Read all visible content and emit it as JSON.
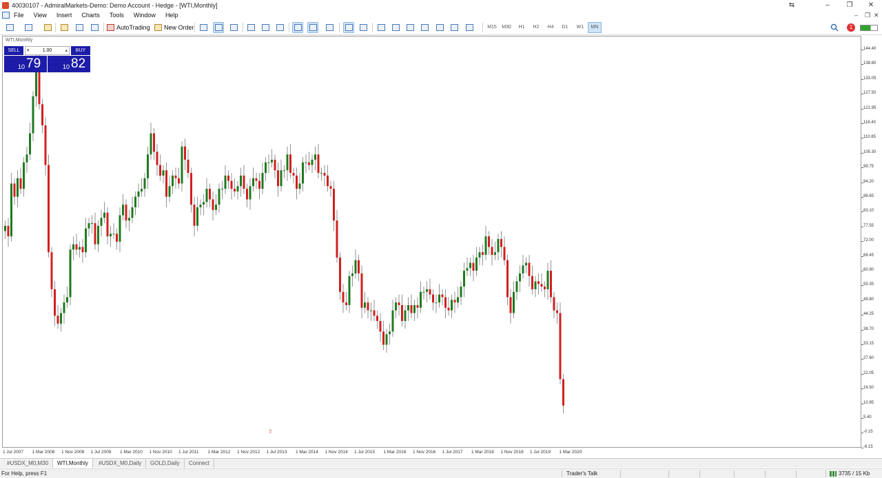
{
  "window": {
    "title": "40030107 - AdmiralMarkets-Demo: Demo Account - Hedge - [WTI,Monthly]",
    "controls": [
      "⇆",
      "–",
      "❐",
      "✕"
    ]
  },
  "menu": {
    "items": [
      "File",
      "View",
      "Insert",
      "Charts",
      "Tools",
      "Window",
      "Help"
    ],
    "mdi_controls": [
      "–",
      "❐",
      "✕"
    ]
  },
  "toolbar": {
    "autotrading_label": "AutoTrading",
    "new_order_label": "New Order",
    "timeframes": [
      "M15",
      "M30",
      "H1",
      "H2",
      "H4",
      "D1",
      "W1",
      "MN"
    ],
    "active_timeframe": "MN",
    "notification_count": "1"
  },
  "chart": {
    "symbol_label": "WTI,Monthly",
    "trade_panel": {
      "sell_label": "SELL",
      "buy_label": "BUY",
      "lot_value": "1.00",
      "sell_price_small": "10",
      "sell_price_big": "79",
      "buy_price_small": "10",
      "buy_price_big": "82"
    },
    "price_labels": [
      "144.40",
      "138.80",
      "133.05",
      "127.50",
      "121.95",
      "116.40",
      "110.85",
      "105.30",
      "99.75",
      "94.20",
      "88.65",
      "83.10",
      "77.55",
      "72.00",
      "66.45",
      "60.90",
      "55.35",
      "49.80",
      "44.25",
      "38.70",
      "33.15",
      "27.60",
      "22.05",
      "16.50",
      "10.95",
      "5.40",
      "-0.15",
      "-6.15"
    ],
    "time_labels": [
      "1 Jul 2007",
      "1 Mar 2008",
      "1 Nov 2008",
      "1 Jul 2009",
      "1 Mar 2010",
      "1 Nov 2010",
      "1 Jul 2011",
      "1 Mar 2012",
      "1 Nov 2012",
      "1 Jul 2013",
      "1 Mar 2014",
      "1 Nov 2014",
      "1 Jul 2015",
      "1 Mar 2016",
      "1 Nov 2016",
      "1 Jul 2017",
      "1 Mar 2018",
      "1 Nov 2018",
      "1 Jul 2019",
      "1 Mar 2020"
    ],
    "up_color": "#1e7a1e",
    "down_color": "#d11f1f"
  },
  "chart_data": {
    "type": "candlestick",
    "symbol": "WTI",
    "timeframe": "Monthly",
    "ylim": [
      -6.15,
      144.4
    ],
    "x_start": "2007-07",
    "x_end": "2020-04",
    "closes": [
      78,
      74,
      94,
      89,
      96,
      92,
      102,
      105,
      113,
      127,
      140,
      124,
      116,
      101,
      68,
      54,
      44,
      41,
      45,
      49,
      51,
      69,
      71,
      69,
      70,
      68,
      77,
      79,
      79,
      71,
      78,
      81,
      83,
      74,
      75,
      75,
      72,
      82,
      86,
      80,
      81,
      85,
      89,
      91,
      92,
      96,
      105,
      113,
      106,
      101,
      97,
      99,
      89,
      93,
      97,
      96,
      94,
      108,
      103,
      98,
      86,
      78,
      85,
      86,
      87,
      92,
      88,
      84,
      86,
      92,
      92,
      97,
      95,
      92,
      91,
      93,
      97,
      92,
      88,
      93,
      96,
      95,
      92,
      98,
      102,
      102,
      103,
      99,
      93,
      99,
      99,
      105,
      98,
      97,
      92,
      94,
      102,
      102,
      101,
      103,
      105,
      98,
      98,
      97,
      93,
      92,
      80,
      66,
      53,
      49,
      48,
      59,
      60,
      65,
      60,
      47,
      49,
      46,
      46,
      44,
      42,
      38,
      33,
      37,
      38,
      46,
      49,
      48,
      42,
      46,
      48,
      45,
      48,
      47,
      53,
      53,
      54,
      52,
      49,
      49,
      52,
      51,
      47,
      46,
      50,
      49,
      51,
      55,
      61,
      62,
      64,
      61,
      66,
      68,
      67,
      74,
      70,
      67,
      68,
      73,
      70,
      65,
      51,
      45,
      53,
      57,
      60,
      63,
      64,
      59,
      54,
      57,
      56,
      55,
      54,
      61,
      51,
      46,
      45,
      20,
      10
    ],
    "note_candles": "Monthly OHLC candles for WTI crude oil, Jul 2007 – Apr 2020"
  },
  "tabs": {
    "items": [
      "#USDX_M0,M30",
      "WTI,Monthly",
      "#USDX_M0,Daily",
      "GOLD,Daily",
      "Connect"
    ],
    "active": 1
  },
  "status": {
    "help_text": "For Help, press F1",
    "traders_talk": "Trader's Talk",
    "traffic": "3735 / 15 Kb"
  }
}
